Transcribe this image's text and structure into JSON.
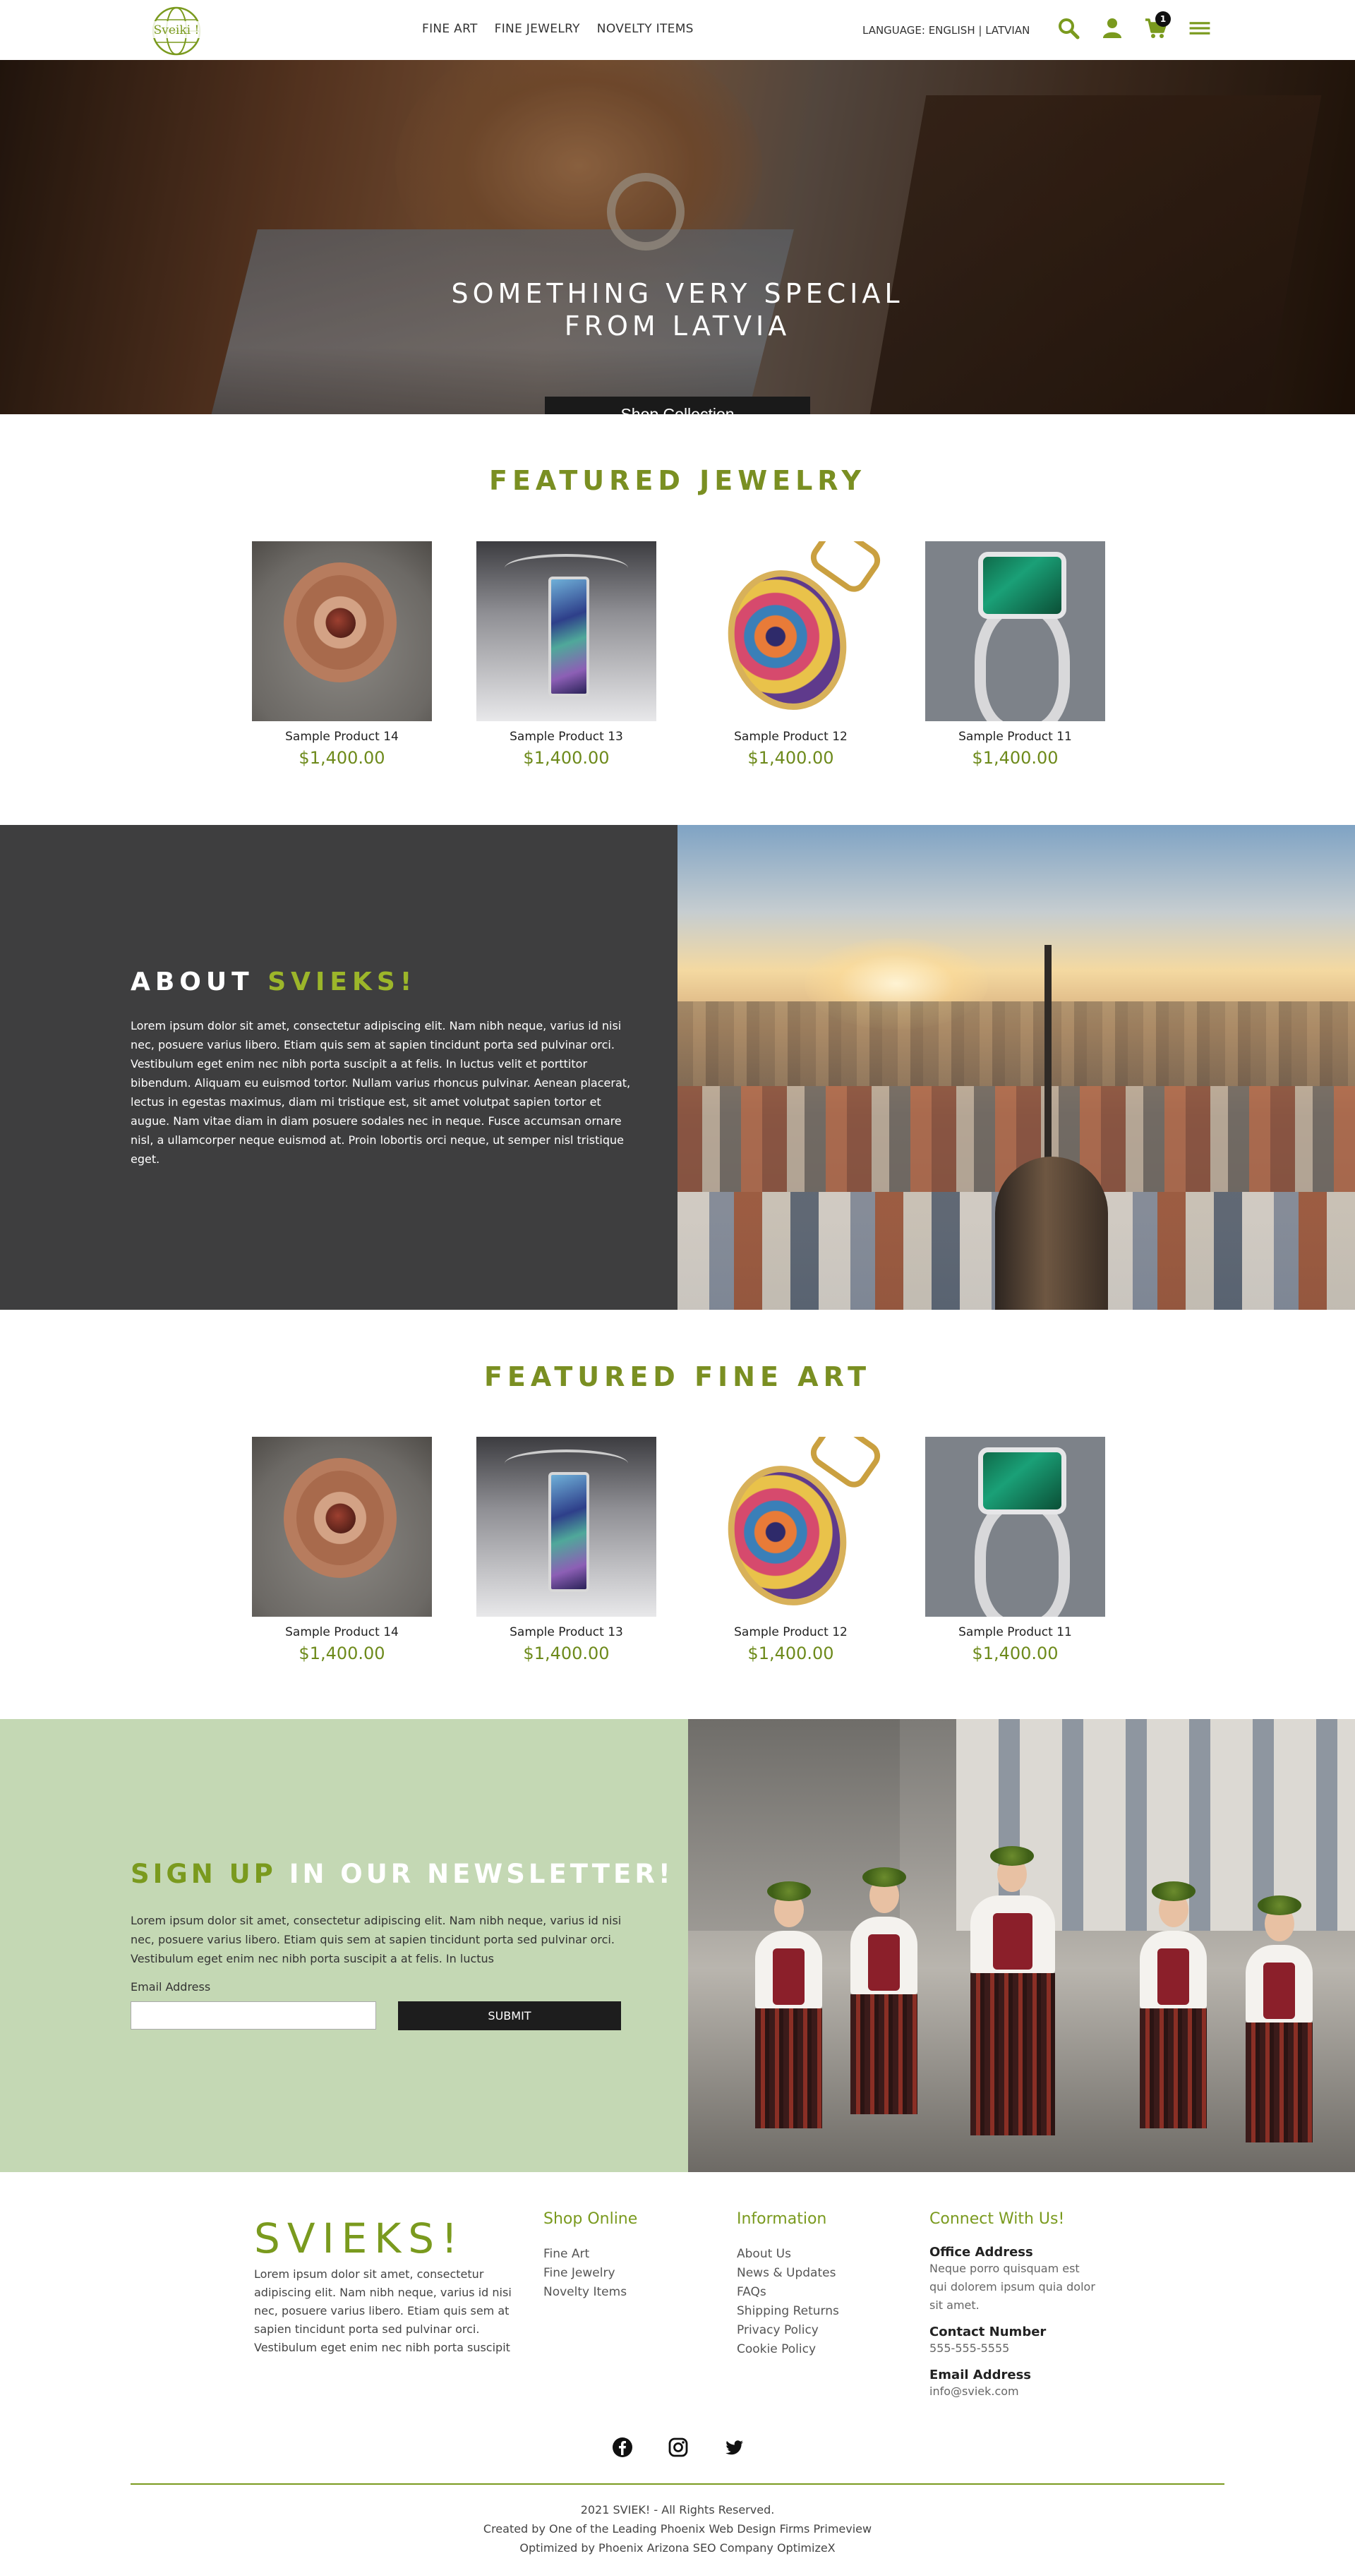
{
  "header": {
    "logo_text": "Sveiki !",
    "nav": [
      "FINE ART",
      "FINE JEWELRY",
      "NOVELTY ITEMS"
    ],
    "language": "LANGUAGE: ENGLISH | LATVIAN",
    "cart_count": "1",
    "icons": [
      "search-icon",
      "user-icon",
      "cart-icon",
      "menu-icon"
    ],
    "accent": "#7a9a1e"
  },
  "hero": {
    "title_line1": "SOMETHING VERY SPECIAL",
    "title_line2": "FROM LATVIA",
    "button": "Shop Collection"
  },
  "featured_jewelry": {
    "title": "FEATURED JEWELRY",
    "products": [
      {
        "name": "Sample Product 14",
        "price": "$1,400.00"
      },
      {
        "name": "Sample Product 13",
        "price": "$1,400.00"
      },
      {
        "name": "Sample Product 12",
        "price": "$1,400.00"
      },
      {
        "name": "Sample Product 11",
        "price": "$1,400.00"
      }
    ]
  },
  "about": {
    "title_a": "ABOUT",
    "title_b": "SVIEKS!",
    "text": "Lorem ipsum dolor sit amet, consectetur adipiscing elit. Nam nibh neque, varius id nisi nec, posuere varius libero. Etiam quis sem at sapien tincidunt porta sed pulvinar orci. Vestibulum eget enim nec nibh porta suscipit a at felis. In luctus velit et porttitor bibendum. Aliquam eu euismod tortor. Nullam varius rhoncus pulvinar. Aenean placerat, lectus in egestas maximus, diam mi tristique est, sit amet volutpat sapien tortor et augue. Nam vitae diam in diam posuere sodales nec in neque. Fusce accumsan ornare nisl, a ullamcorper neque euismod at. Proin lobortis orci neque, ut semper nisl tristique eget."
  },
  "featured_art": {
    "title": "FEATURED FINE ART",
    "products": [
      {
        "name": "Sample Product 14",
        "price": "$1,400.00"
      },
      {
        "name": "Sample Product 13",
        "price": "$1,400.00"
      },
      {
        "name": "Sample Product 12",
        "price": "$1,400.00"
      },
      {
        "name": "Sample Product 11",
        "price": "$1,400.00"
      }
    ]
  },
  "newsletter": {
    "title_a": "SIGN UP",
    "title_b": "IN OUR NEWSLETTER!",
    "text": "Lorem ipsum dolor sit amet, consectetur adipiscing elit. Nam nibh neque, varius id nisi nec, posuere varius libero. Etiam quis sem at sapien tincidunt porta sed pulvinar orci. Vestibulum eget enim nec nibh porta suscipit a at felis. In luctus",
    "email_label": "Email Address",
    "email_value": "",
    "submit": "SUBMIT"
  },
  "footer": {
    "brand": "SVIEKS!",
    "about": "Lorem ipsum dolor sit amet, consectetur adipiscing elit. Nam nibh neque, varius id nisi nec, posuere varius libero. Etiam quis sem at sapien tincidunt porta sed pulvinar orci. Vestibulum eget enim nec nibh porta suscipit",
    "shop": {
      "title": "Shop Online",
      "links": [
        "Fine Art",
        "Fine Jewelry",
        "Novelty Items"
      ]
    },
    "info": {
      "title": "Information",
      "links": [
        "About Us",
        "News & Updates",
        "FAQs",
        "Shipping Returns",
        "Privacy Policy",
        "Cookie Policy"
      ]
    },
    "connect": {
      "title": "Connect With Us!",
      "office_label": "Office Address",
      "office_value": "Neque porro quisquam est qui dolorem ipsum quia dolor sit amet.",
      "phone_label": "Contact Number",
      "phone_value": "555-555-5555",
      "email_label": "Email Address",
      "email_value": "info@sviek.com"
    },
    "social": [
      "facebook-icon",
      "instagram-icon",
      "twitter-icon"
    ],
    "copy1": "2021 SVIEK! - All Rights Reserved.",
    "copy2": "Created by One of the Leading Phoenix Web Design Firms Primeview",
    "copy3": "Optimized by Phoenix Arizona SEO Company OptimizeX"
  }
}
